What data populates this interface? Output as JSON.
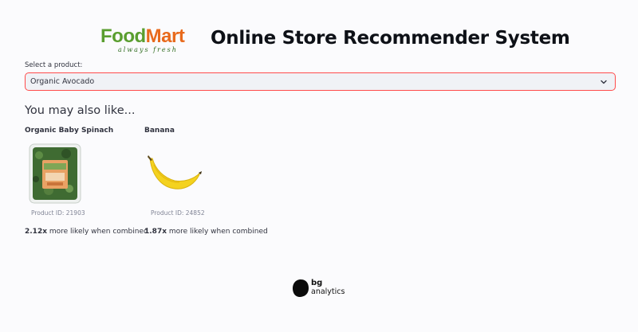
{
  "header": {
    "logo": {
      "word_food": "Food",
      "word_mart": "Mart",
      "tagline": "always fresh"
    },
    "title": "Online Store Recommender System"
  },
  "selector": {
    "label": "Select a product:",
    "selected_value": "Organic Avocado",
    "accent_color": "#ff4b4b"
  },
  "recommendations": {
    "heading": "You may also like...",
    "items": [
      {
        "name": "Organic Baby Spinach",
        "product_id": "Product ID: 21903",
        "lift_value": "2.12x",
        "lift_text": " more likely when combined",
        "image": "spinach-package-image"
      },
      {
        "name": "Banana",
        "product_id": "Product ID: 24852",
        "lift_value": "1.87x",
        "lift_text": " more likely when combined",
        "image": "banana-image"
      }
    ]
  },
  "footer": {
    "brand_bg": "bg",
    "brand_analytics": "analytics"
  },
  "colors": {
    "background": "#fbfbfd",
    "logo_green": "#5a9e2f",
    "logo_orange": "#e86a1c",
    "text": "#31333f"
  }
}
